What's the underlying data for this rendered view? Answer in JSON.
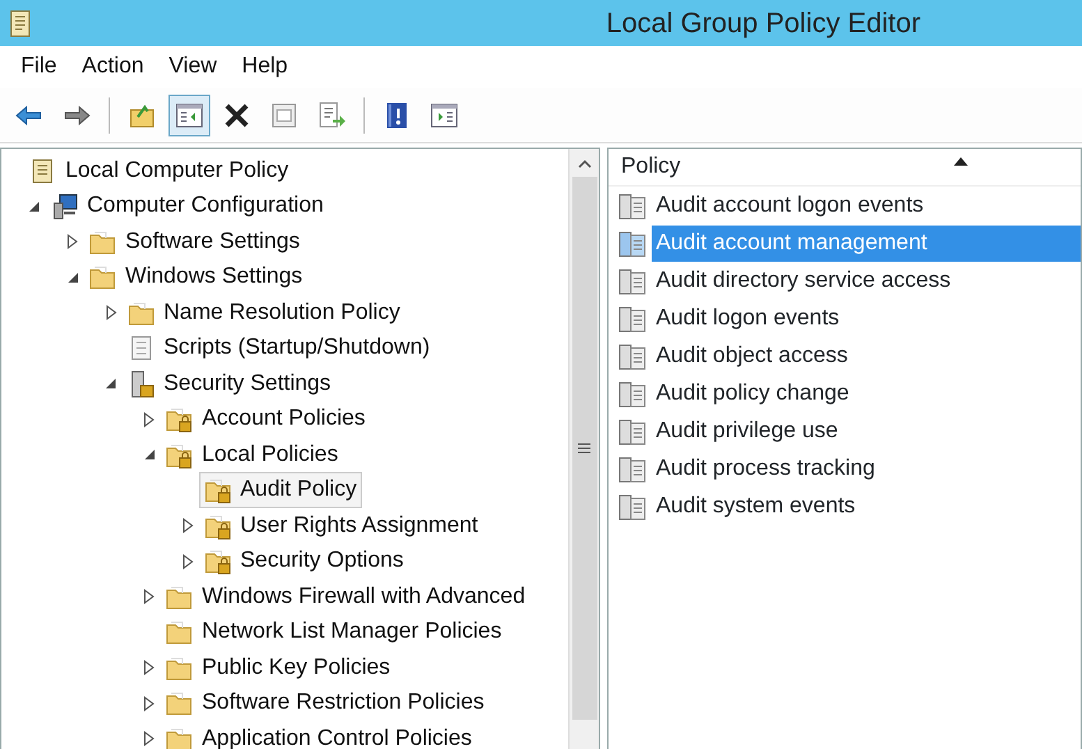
{
  "window": {
    "title": "Local Group Policy Editor"
  },
  "menu": [
    "File",
    "Action",
    "View",
    "Help"
  ],
  "toolbar": [
    {
      "kind": "back",
      "pressed": false
    },
    {
      "kind": "forward",
      "pressed": false
    },
    {
      "kind": "sep"
    },
    {
      "kind": "up",
      "pressed": false
    },
    {
      "kind": "tree",
      "pressed": true
    },
    {
      "kind": "delete",
      "pressed": false
    },
    {
      "kind": "properties",
      "pressed": false
    },
    {
      "kind": "export",
      "pressed": false
    },
    {
      "kind": "sep"
    },
    {
      "kind": "help",
      "pressed": false
    },
    {
      "kind": "actionpane",
      "pressed": false
    }
  ],
  "tree": [
    {
      "label": "Local Computer Policy",
      "kind": "policy",
      "selected": false,
      "children": [
        {
          "label": "Computer Configuration",
          "kind": "computer",
          "expanded": true,
          "selected": false,
          "children": [
            {
              "label": "Software Settings",
              "kind": "folder",
              "expanded": false,
              "selected": false
            },
            {
              "label": "Windows Settings",
              "kind": "folder",
              "expanded": true,
              "selected": false,
              "children": [
                {
                  "label": "Name Resolution Policy",
                  "kind": "folder",
                  "expanded": false,
                  "selected": false
                },
                {
                  "label": "Scripts (Startup/Shutdown)",
                  "kind": "scripts",
                  "selected": false
                },
                {
                  "label": "Security Settings",
                  "kind": "security",
                  "expanded": true,
                  "selected": false,
                  "children": [
                    {
                      "label": "Account Policies",
                      "kind": "lockfolder",
                      "expanded": false,
                      "selected": false
                    },
                    {
                      "label": "Local Policies",
                      "kind": "lockfolder",
                      "expanded": true,
                      "selected": false,
                      "children": [
                        {
                          "label": "Audit Policy",
                          "kind": "lockfolder",
                          "selected": true
                        },
                        {
                          "label": "User Rights Assignment",
                          "kind": "lockfolder",
                          "expanded": false,
                          "selected": false
                        },
                        {
                          "label": "Security Options",
                          "kind": "lockfolder",
                          "expanded": false,
                          "selected": false
                        }
                      ]
                    },
                    {
                      "label": "Windows Firewall with Advanced",
                      "kind": "folder",
                      "expanded": false,
                      "selected": false
                    },
                    {
                      "label": "Network List Manager Policies",
                      "kind": "folder",
                      "selected": false
                    },
                    {
                      "label": "Public Key Policies",
                      "kind": "folder",
                      "expanded": false,
                      "selected": false
                    },
                    {
                      "label": "Software Restriction Policies",
                      "kind": "folder",
                      "expanded": false,
                      "selected": false
                    },
                    {
                      "label": "Application Control Policies",
                      "kind": "folder",
                      "expanded": false,
                      "selected": false
                    }
                  ]
                }
              ]
            }
          ]
        }
      ]
    }
  ],
  "list": {
    "column": "Policy",
    "items": [
      {
        "label": "Audit account logon events",
        "selected": false
      },
      {
        "label": "Audit account management",
        "selected": true
      },
      {
        "label": "Audit directory service access",
        "selected": false
      },
      {
        "label": "Audit logon events",
        "selected": false
      },
      {
        "label": "Audit object access",
        "selected": false
      },
      {
        "label": "Audit policy change",
        "selected": false
      },
      {
        "label": "Audit privilege use",
        "selected": false
      },
      {
        "label": "Audit process tracking",
        "selected": false
      },
      {
        "label": "Audit system events",
        "selected": false
      }
    ]
  }
}
